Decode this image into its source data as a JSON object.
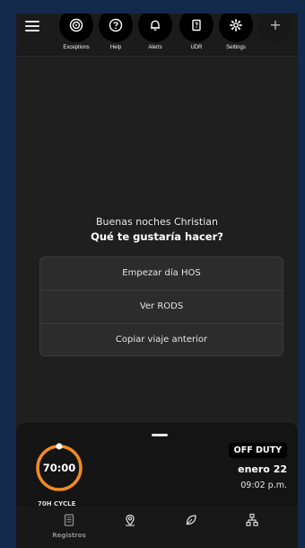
{
  "toolbar": {
    "items": [
      {
        "label": "Exceptions",
        "icon": "target-icon"
      },
      {
        "label": "Help",
        "icon": "help-icon"
      },
      {
        "label": "Alerts",
        "icon": "bell-icon"
      },
      {
        "label": "UDR",
        "icon": "document-icon"
      },
      {
        "label": "Settings",
        "icon": "gear-icon"
      }
    ],
    "plus": "+"
  },
  "greeting": {
    "line1": "Buenas noches Christian",
    "question": "Qué te gustaría hacer?"
  },
  "options": [
    {
      "label": "Empezar día HOS"
    },
    {
      "label": "Ver RODS"
    },
    {
      "label": "Copiar viaje anterior"
    }
  ],
  "status": {
    "cycle_time": "70:00",
    "cycle_label": "70H CYCLE",
    "duty_status": "OFF DUTY",
    "date": "enero 22",
    "time": "09:02 p.m."
  },
  "bottom_nav": {
    "items": [
      {
        "label": "Registros",
        "icon": "logbook-icon"
      },
      {
        "label": "",
        "icon": "map-pin-icon"
      },
      {
        "label": "",
        "icon": "leaf-icon"
      },
      {
        "label": "",
        "icon": "network-icon"
      }
    ]
  },
  "colors": {
    "accent": "#f08a24",
    "background": "#1f1f1f",
    "frame": "#13294b"
  }
}
